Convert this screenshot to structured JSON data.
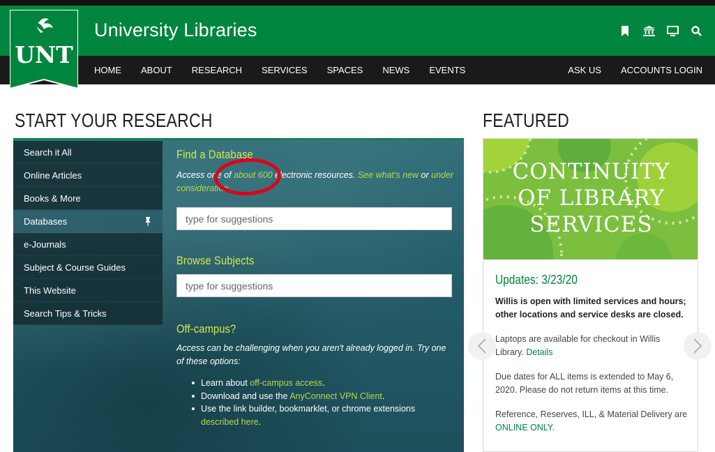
{
  "header": {
    "site_title": "University Libraries",
    "logo_text": "UNT",
    "util_icons": [
      "bookmark-icon",
      "institution-icon",
      "monitor-icon",
      "search-icon"
    ]
  },
  "nav": {
    "items": [
      "HOME",
      "ABOUT",
      "RESEARCH",
      "SERVICES",
      "SPACES",
      "NEWS",
      "EVENTS"
    ],
    "right_items": [
      "ASK US",
      "ACCOUNTS LOGIN"
    ]
  },
  "research": {
    "heading": "START YOUR RESEARCH",
    "side_items": [
      "Search it All",
      "Online Articles",
      "Books & More",
      "Databases",
      "e-Journals",
      "Subject & Course Guides",
      "This Website",
      "Search Tips & Tricks"
    ],
    "active_item": "Databases",
    "find_db": {
      "heading": "Find a Database",
      "text_pre": "Access one of ",
      "link_count": "about 600",
      "text_mid": " electronic resources. ",
      "link_new": "See what's new",
      "text_or": " or ",
      "link_consideration": "under consideration",
      "text_end": ".",
      "placeholder": "type for suggestions"
    },
    "browse": {
      "heading": "Browse Subjects",
      "placeholder": "type for suggestions"
    },
    "offcampus": {
      "heading": "Off-campus?",
      "text": "Access can be challenging when you aren't already logged in. Try one of these options:",
      "bullets": [
        {
          "pre": "Learn about ",
          "link": "off-campus access",
          "post": "."
        },
        {
          "pre": "Download and use the ",
          "link": "AnyConnect VPN Client",
          "post": "."
        },
        {
          "pre": "Use the link builder, bookmarklet, or chrome extensions ",
          "link": "described here",
          "post": "."
        }
      ]
    }
  },
  "featured": {
    "heading": "FEATURED",
    "image_title_lines": [
      "CONTINUITY",
      "OF LIBRARY",
      "SERVICES"
    ],
    "update_title": "Updates: 3/23/20",
    "bold_text": "Willis is open with limited services and hours; other locations and service desks are closed.",
    "p1_text": "Laptops are available for checkout in Willis Library. ",
    "p1_link": "Details",
    "p2_text": "Due dates for ALL items is extended to May 6, 2020. Please do not return items at this time.",
    "p3_text": "Reference, Reserves, ILL, & Material Delivery are ",
    "p3_link": "ONLINE ONLY",
    "p3_end": "."
  },
  "colors": {
    "unt_green": "#00853e",
    "nav_black": "#1a1a1a",
    "accent_yellow_green": "#d9e84a",
    "annotation_red": "#e0001a"
  }
}
